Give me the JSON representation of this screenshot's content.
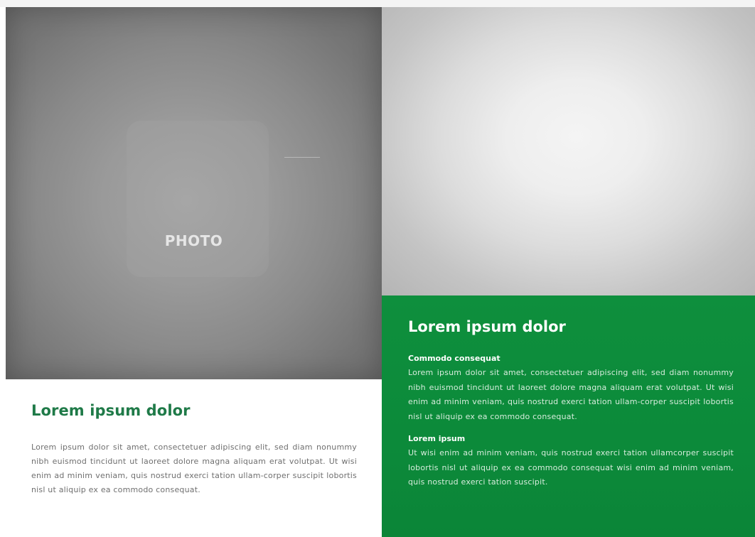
{
  "left": {
    "photo_label": "PHOTO",
    "title": "Lorem ipsum dolor",
    "body": "Lorem ipsum dolor sit amet, consectetuer adipiscing elit, sed diam nonummy nibh euismod tincidunt ut laoreet dolore magna aliquam erat volutpat. Ut wisi enim ad minim veniam, quis nostrud exerci tation ullam-corper suscipit lobortis nisl ut aliquip ex ea commodo consequat."
  },
  "right": {
    "title": "Lorem ipsum dolor",
    "section1": {
      "heading": "Commodo consequat",
      "body": "Lorem ipsum dolor sit amet, consectetuer adipiscing elit, sed diam nonummy nibh euismod tincidunt ut laoreet dolore magna aliquam erat volutpat. Ut wisi enim ad minim veniam, quis nostrud exerci tation ullam-corper suscipit lobortis nisl ut aliquip ex ea commodo consequat."
    },
    "section2": {
      "heading": "Lorem ipsum",
      "body": "Ut wisi enim ad minim veniam, quis nostrud exerci tation ullamcorper suscipit lobortis nisl ut aliquip ex ea commodo consequat wisi enim ad minim veniam, quis nostrud exerci tation suscipit."
    }
  },
  "colors": {
    "accent_green": "#0d8c3c",
    "title_green": "#1f7a48",
    "photo_gray": "#8a8a8a"
  }
}
